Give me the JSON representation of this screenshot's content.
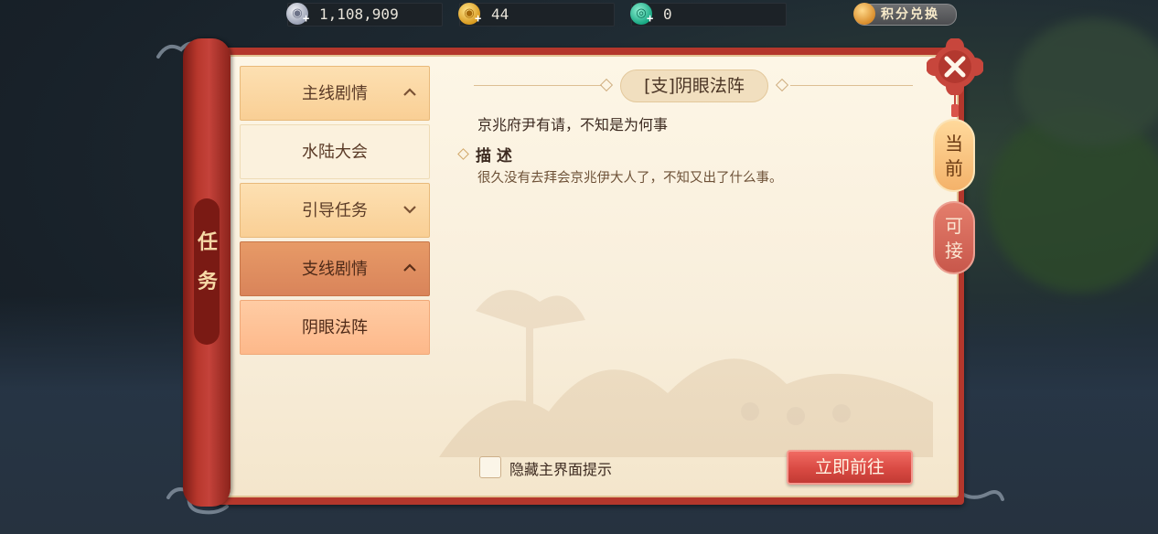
{
  "currency": {
    "silver": {
      "icon": "silver-coin-icon",
      "value": "1,108,909"
    },
    "gold": {
      "icon": "gold-coin-icon",
      "value": "44"
    },
    "jade": {
      "icon": "jade-icon",
      "value": "0"
    }
  },
  "exchange": {
    "label": "积分兑换",
    "icon": "money-bag-icon"
  },
  "panel": {
    "side_title_1": "任",
    "side_title_2": "务"
  },
  "quest_list": {
    "main_story": "主线剧情",
    "water_land": "水陆大会",
    "guide": "引导任务",
    "side_story": "支线剧情",
    "yin_eye": "阴眼法阵"
  },
  "detail": {
    "title": "[支]阴眼法阵",
    "summary": "京兆府尹有请，不知是为何事",
    "desc_heading": "描 述",
    "desc_text": "很久没有去拜会京兆伊大人了，不知又出了什么事。"
  },
  "footer": {
    "hide_hint_label": "隐藏主界面提示",
    "go_button": "立即前往"
  },
  "tabs": {
    "current_1": "当",
    "current_2": "前",
    "available_1": "可",
    "available_2": "接"
  },
  "colors": {
    "frame_red": "#b4372c",
    "paper": "#fdf6e6",
    "go_button": "#d94a43",
    "selected_item": "#fdb88a"
  }
}
